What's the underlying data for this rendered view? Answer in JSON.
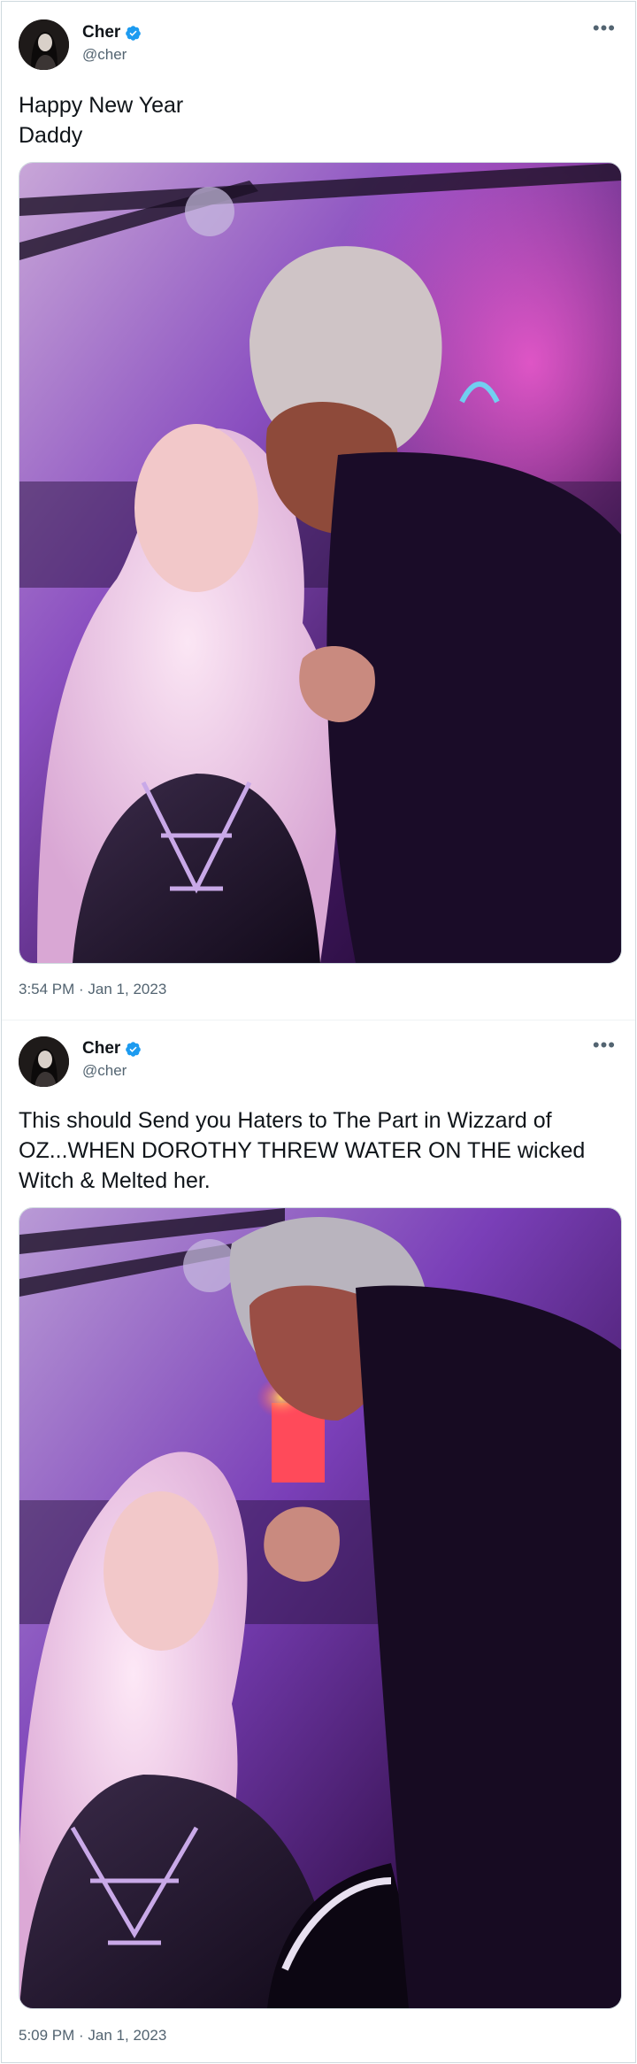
{
  "tweets": [
    {
      "display_name": "Cher",
      "handle": "@cher",
      "text": "Happy New Year\nDaddy",
      "timestamp": "3:54 PM · Jan 1, 2023",
      "more_icon": "more-horizontal-icon"
    },
    {
      "display_name": "Cher",
      "handle": "@cher",
      "text": "This should Send you Haters to The Part in Wizzard of OZ...WHEN DOROTHY THREW WATER ON THE wicked Witch & Melted her.",
      "timestamp": "5:09 PM · Jan 1, 2023",
      "more_icon": "more-horizontal-icon"
    }
  ],
  "colors": {
    "verified": "#1d9bf0",
    "text_primary": "#0f1419",
    "text_secondary": "#536471",
    "border": "#cfd9de"
  }
}
